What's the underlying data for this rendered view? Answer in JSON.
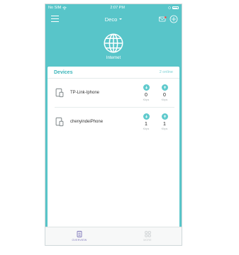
{
  "status_bar": {
    "carrier": "No SIM",
    "time": "2:07 PM"
  },
  "header": {
    "title": "Deco"
  },
  "internet": {
    "label": "Internet"
  },
  "devices": {
    "title": "Devices",
    "online_count": "2 online",
    "items": [
      {
        "name": "TP-Link-Iphone",
        "download": "0",
        "upload": "0",
        "unit": "Kbps"
      },
      {
        "name": "chenyindeiPhone",
        "download": "1",
        "upload": "1",
        "unit": "Kbps"
      }
    ]
  },
  "tabs": [
    {
      "label": "OVERVIEW",
      "active": true
    },
    {
      "label": "MORE",
      "active": false
    }
  ],
  "colors": {
    "accent": "#58c5c9",
    "tab_active": "#7b73b8"
  }
}
